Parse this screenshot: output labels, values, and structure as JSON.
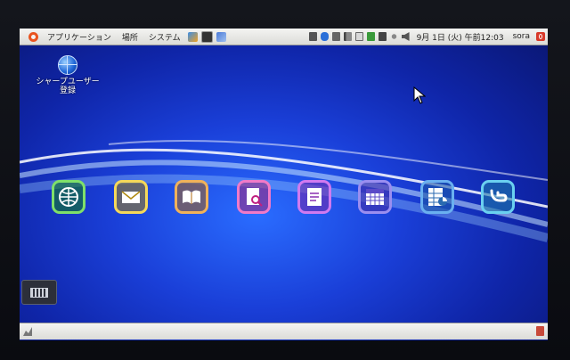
{
  "top_panel": {
    "menus": [
      "アプリケーション",
      "場所",
      "システム"
    ],
    "date": "9月 1日 (火) 午前12:03",
    "user": "sora",
    "tray_icons": [
      "network-icon",
      "bluetooth-icon",
      "font-icon",
      "signal-icon",
      "battery-icon",
      "display-icon",
      "gear-icon",
      "volume-icon"
    ]
  },
  "desktop": {
    "icon_label": "シャープユーザー\n登録"
  },
  "apps": [
    {
      "name": "browser",
      "color": "#7fe06a"
    },
    {
      "name": "mail",
      "color": "#f5d85a"
    },
    {
      "name": "book",
      "color": "#f0b25a"
    },
    {
      "name": "dictionary",
      "color": "#f07ac8"
    },
    {
      "name": "notes",
      "color": "#d07af0"
    },
    {
      "name": "calendar",
      "color": "#9a8ef0"
    },
    {
      "name": "spreadsheet",
      "color": "#6ab0f0"
    },
    {
      "name": "twitter",
      "color": "#6ad0f0"
    }
  ]
}
